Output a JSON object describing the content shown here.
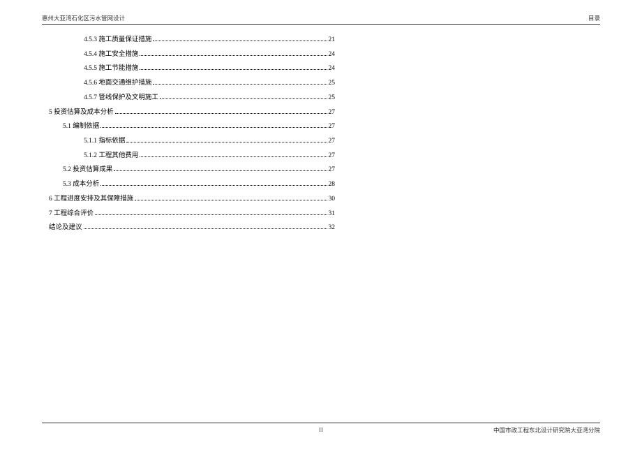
{
  "header": {
    "left": "惠州大亚湾石化区污水管网设计",
    "right": "目录"
  },
  "toc": [
    {
      "level": 2,
      "label": "4.5.3 施工质量保证措施",
      "page": "21"
    },
    {
      "level": 2,
      "label": "4.5.4 施工安全措施",
      "page": "24"
    },
    {
      "level": 2,
      "label": "4.5.5 施工节能措施",
      "page": "24"
    },
    {
      "level": 2,
      "label": "4.5.6 地面交通维护措施",
      "page": "25"
    },
    {
      "level": 2,
      "label": "4.5.7 管线保护及文明施工",
      "page": "25"
    },
    {
      "level": 0,
      "label": "5 投资估算及成本分析",
      "page": "27"
    },
    {
      "level": 1,
      "label": "5.1 编制依据",
      "page": "27"
    },
    {
      "level": 2,
      "label": "5.1.1 指标依据",
      "page": "27"
    },
    {
      "level": 2,
      "label": "5.1.2 工程其他费用",
      "page": "27"
    },
    {
      "level": 1,
      "label": "5.2 投资估算成果",
      "page": "27"
    },
    {
      "level": 1,
      "label": "5.3 成本分析",
      "page": "28"
    },
    {
      "level": 0,
      "label": "6 工程进度安排及其保障措施",
      "page": "30"
    },
    {
      "level": 0,
      "label": "7 工程综合评价",
      "page": "31"
    },
    {
      "level": 0,
      "label": "结论及建议",
      "page": "32"
    }
  ],
  "footer": {
    "center": "II",
    "right": "中国市政工程东北设计研究院大亚湾分院"
  }
}
